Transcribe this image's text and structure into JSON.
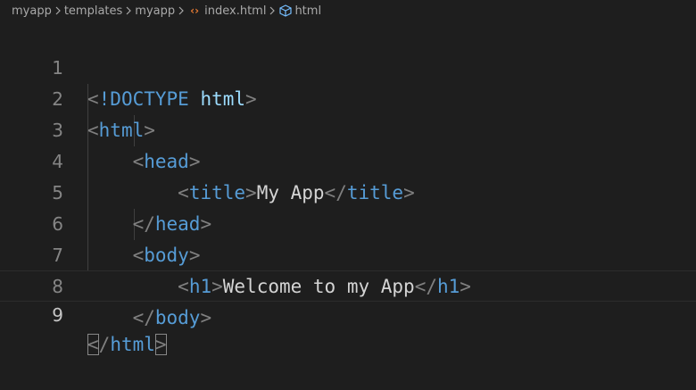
{
  "breadcrumb": {
    "items": [
      "myapp",
      "templates",
      "myapp",
      "index.html",
      "html"
    ]
  },
  "editor": {
    "lines": [
      {
        "number": "1"
      },
      {
        "number": "2"
      },
      {
        "number": "3"
      },
      {
        "number": "4"
      },
      {
        "number": "5"
      },
      {
        "number": "6"
      },
      {
        "number": "7"
      },
      {
        "number": "8"
      },
      {
        "number": "9"
      }
    ],
    "tokens": {
      "doctype": "!DOCTYPE",
      "doctype_arg": "html",
      "html": "html",
      "head": "head",
      "title": "title",
      "title_text": "My App",
      "body": "body",
      "h1": "h1",
      "h1_text": "Welcome to my App"
    },
    "active_line": "9"
  },
  "colors": {
    "background": "#1e1e1e",
    "tag": "#569cd6",
    "punctuation": "#808080",
    "text": "#d4d4d4",
    "line_number": "#858585",
    "file_icon": "#e37933"
  },
  "icons": {
    "file": "html-file-icon",
    "symbol": "symbol-element-icon",
    "separator": "chevron-right-icon"
  }
}
